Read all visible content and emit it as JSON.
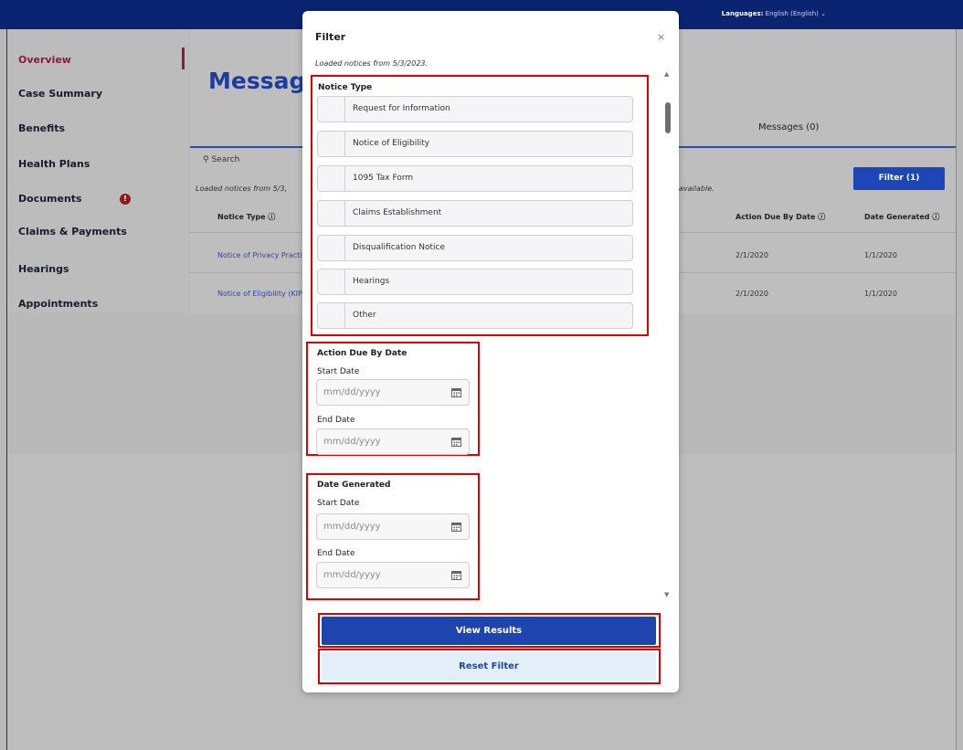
{
  "header": {
    "language_label": "Languages:",
    "language_value": "English (English)"
  },
  "sidebar": {
    "items": [
      {
        "label": "Overview"
      },
      {
        "label": "Case Summary"
      },
      {
        "label": "Benefits"
      },
      {
        "label": "Health Plans"
      },
      {
        "label": "Documents"
      },
      {
        "label": "Claims & Payments"
      },
      {
        "label": "Hearings"
      },
      {
        "label": "Appointments"
      }
    ],
    "documents_badge": "!"
  },
  "main": {
    "title": "Messag",
    "tab_messages": "Messages (0)",
    "search_label": "Search",
    "loaded_text": "Loaded notices from 5/3,",
    "available_text": "available.",
    "filter_button": "Filter (1)",
    "columns": {
      "notice_type": "Notice Type",
      "action_due": "Action Due By Date",
      "date_generated": "Date Generated"
    },
    "rows": [
      {
        "notice": "Notice of Privacy Practi",
        "action_due": "2/1/2020",
        "generated": "1/1/2020"
      },
      {
        "notice": "Notice of Eligibility (KIP-",
        "action_due": "2/1/2020",
        "generated": "1/1/2020"
      }
    ]
  },
  "modal": {
    "title": "Filter",
    "close": "×",
    "loaded_text": "Loaded notices from 5/3/2023.",
    "notice_type_label": "Notice Type",
    "notice_types": [
      "Request for Information",
      "Notice of Eligibility",
      "1095 Tax Form",
      "Claims Establishment",
      "Disqualification Notice",
      "Hearings",
      "Other"
    ],
    "action_due_label": "Action Due By Date",
    "date_generated_label": "Date Generated",
    "start_date_label": "Start Date",
    "end_date_label": "End Date",
    "date_placeholder": "mm/dd/yyyy",
    "view_results": "View Results",
    "reset_filter": "Reset Filter"
  },
  "colors": {
    "header_navy": "#0a2472",
    "primary_blue": "#1d45ad",
    "highlight_red": "#e00000",
    "active_maroon": "#8a1a3a"
  },
  "icons": {
    "search": "search-icon",
    "info": "info-icon",
    "calendar": "calendar-icon",
    "close": "close-icon",
    "chevron": "chevron-down-icon"
  }
}
